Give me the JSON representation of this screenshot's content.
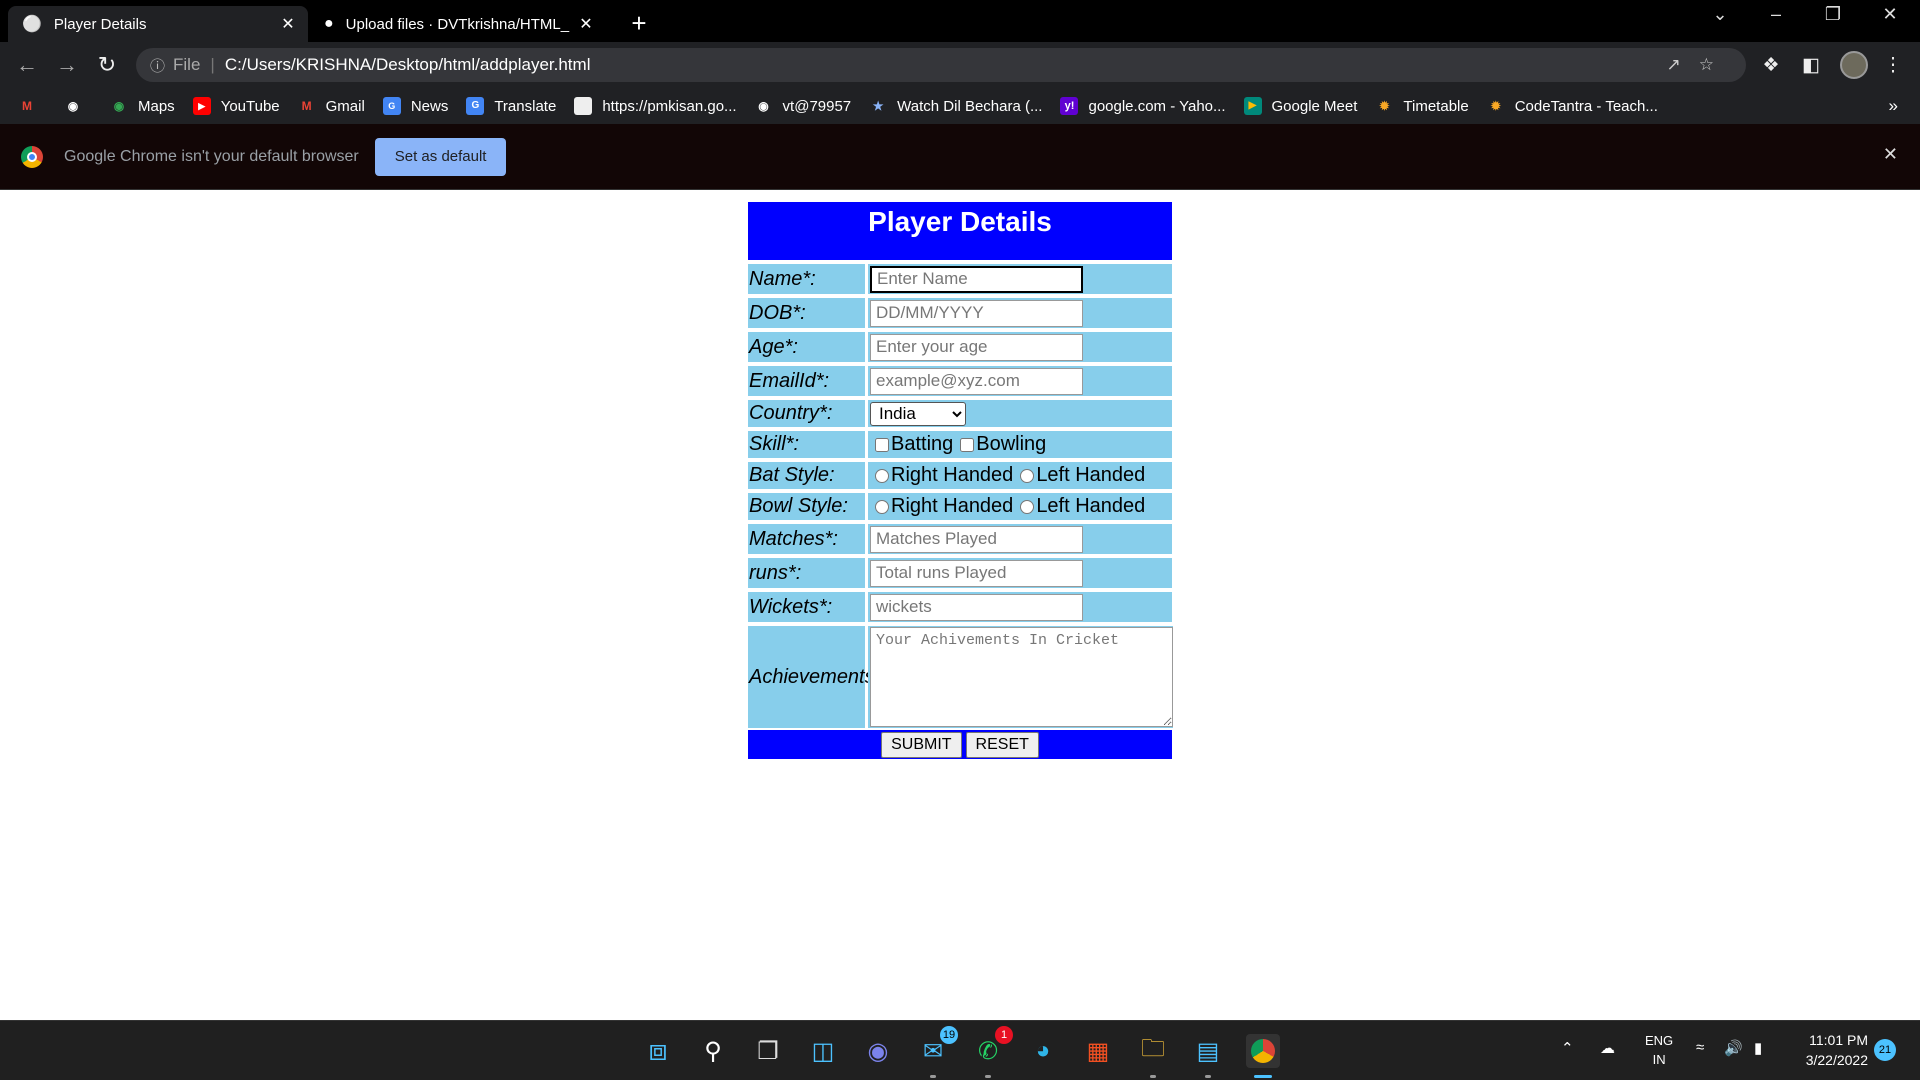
{
  "tabs": [
    {
      "title": "Player Details",
      "active": true
    },
    {
      "title": "Upload files · DVTkrishna/HTML_",
      "active": false
    }
  ],
  "address": {
    "prefix": "File",
    "url": "C:/Users/KRISHNA/Desktop/html/addplayer.html"
  },
  "bookmarks": [
    {
      "label": "",
      "icon": "gmail-icon"
    },
    {
      "label": "",
      "icon": "globe-icon"
    },
    {
      "label": "Maps",
      "icon": "maps-icon"
    },
    {
      "label": "YouTube",
      "icon": "youtube-icon"
    },
    {
      "label": "Gmail",
      "icon": "gmail-icon"
    },
    {
      "label": "News",
      "icon": "news-icon"
    },
    {
      "label": "Translate",
      "icon": "translate-icon"
    },
    {
      "label": "https://pmkisan.go...",
      "icon": "page-icon"
    },
    {
      "label": "vt@79957",
      "icon": "globe-icon"
    },
    {
      "label": "Watch Dil Bechara (...",
      "icon": "star-icon"
    },
    {
      "label": "google.com - Yaho...",
      "icon": "yahoo-icon"
    },
    {
      "label": "Google Meet",
      "icon": "meet-icon"
    },
    {
      "label": "Timetable",
      "icon": "sun-icon"
    },
    {
      "label": "CodeTantra - Teach...",
      "icon": "sun-icon"
    }
  ],
  "infobar": {
    "message": "Google Chrome isn't your default browser",
    "button": "Set as default"
  },
  "form": {
    "title": "Player Details",
    "name_label": "Name*:",
    "name_placeholder": "Enter Name",
    "dob_label": "DOB*:",
    "dob_placeholder": "DD/MM/YYYY",
    "age_label": "Age*:",
    "age_placeholder": "Enter your age",
    "email_label": "EmailId*:",
    "email_placeholder": "example@xyz.com",
    "country_label": "Country*:",
    "country_value": "India",
    "skill_label": "Skill*:",
    "skill_opt1": "Batting",
    "skill_opt2": "Bowling",
    "bat_label": "Bat Style:",
    "bat_opt1": "Right Handed",
    "bat_opt2": "Left Handed",
    "bowl_label": "Bowl Style:",
    "bowl_opt1": "Right Handed",
    "bowl_opt2": "Left Handed",
    "matches_label": "Matches*:",
    "matches_placeholder": "Matches Played",
    "runs_label": "runs*:",
    "runs_placeholder": "Total runs Played",
    "wickets_label": "Wickets*:",
    "wickets_placeholder": "wickets",
    "achievements_label": "Achievements:",
    "achievements_placeholder": "Your Achivements In Cricket",
    "submit": "SUBMIT",
    "reset": "RESET",
    "colors": {
      "header": "#0000ff",
      "row": "#87ceeb"
    }
  },
  "taskbar": {
    "mail_badge": "19",
    "whatsapp_badge": "1",
    "lang_top": "ENG",
    "lang_bottom": "IN",
    "time": "11:01 PM",
    "date": "3/22/2022",
    "notifications": "21"
  }
}
